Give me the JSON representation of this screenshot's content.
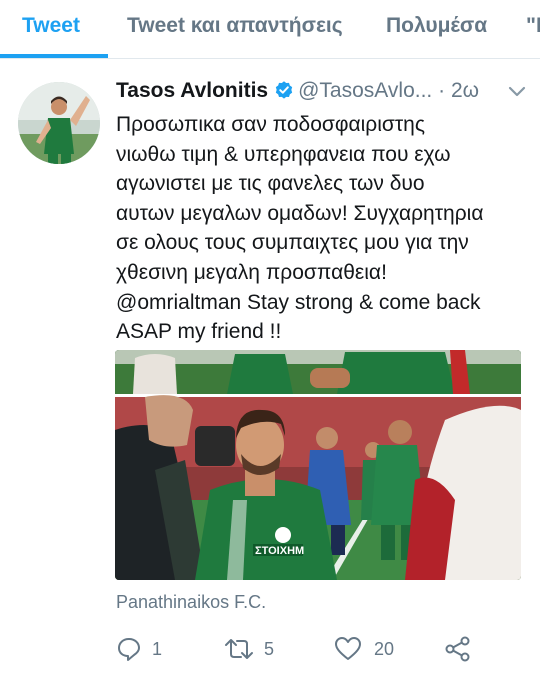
{
  "tabs": [
    {
      "label": "Tweet"
    },
    {
      "label": "Tweet και απαντήσεις"
    },
    {
      "label": "Πολυμέσα"
    },
    {
      "label": "\"Ι"
    }
  ],
  "tweet": {
    "author_name": "Tasos Avlonitis",
    "handle": "@TasosAvlo...",
    "separator": "·",
    "time": "2ω",
    "text_lines": [
      "Προσωπικα σαν ποδοσφαιριστης",
      "νιωθω τιμη & υπερηφανεια που εχω",
      "αγωνιστει με τις φανελες των δυο",
      "αυτων μεγαλων ομαδων! Συγχαρητηρια",
      "σε ολους τους συμπαιχτες μου για την",
      "χθεσινη μεγαλη προσπαθεια!",
      "@omrialtman Stay strong & come back",
      "ASAP my friend !!"
    ],
    "media_source": "Panathinaikos F.C.",
    "jersey_text": "ΣΤΟΙΧΗΜ",
    "counts": {
      "replies": "1",
      "retweets": "5",
      "likes": "20"
    }
  },
  "colors": {
    "accent": "#1da1f2",
    "muted": "#657786",
    "text": "#14171a",
    "jersey_green": "#1f7a3e"
  },
  "icons": [
    "verified-badge-icon",
    "chevron-down-icon",
    "reply-icon",
    "retweet-icon",
    "like-icon",
    "share-icon"
  ]
}
